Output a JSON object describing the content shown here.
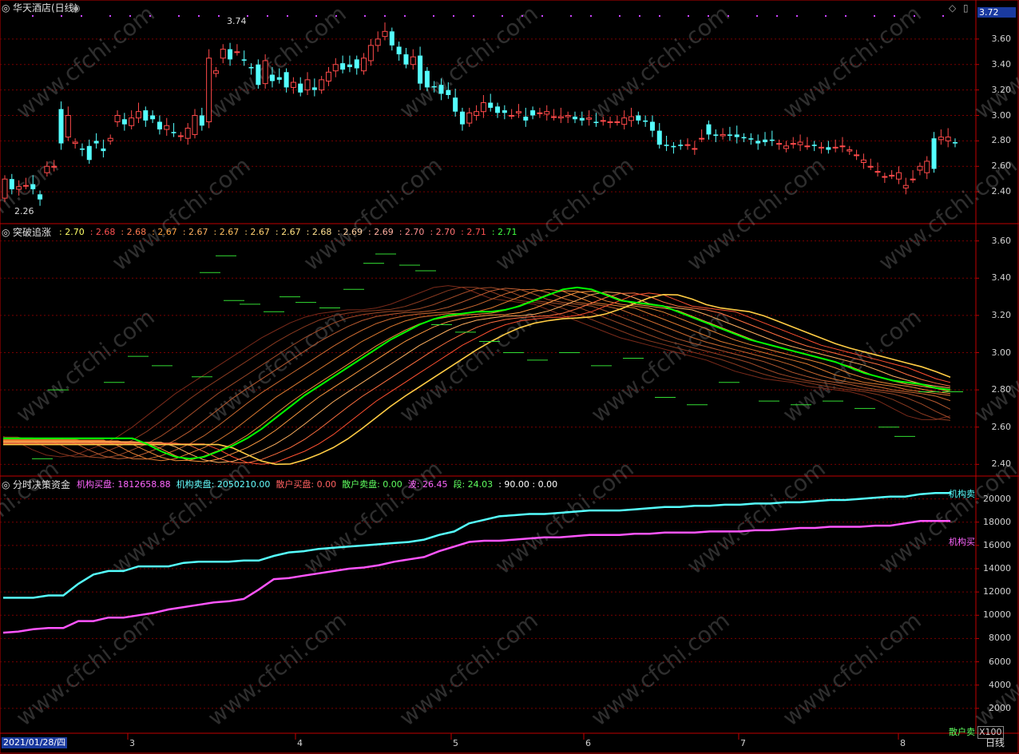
{
  "colors": {
    "up": "#ff4a4a",
    "down": "#54ffff",
    "axis": "#c00000",
    "grid": "#7a0000",
    "text": "#dddddd",
    "green": "#00ff00",
    "magenta": "#ff55ff",
    "cyan": "#55ffff"
  },
  "panel1": {
    "title": "华天酒店(日线)",
    "last_price": "3.72",
    "high_mark": "3.74",
    "low_mark": "2.26",
    "y_ticks": [
      "3.60",
      "3.40",
      "3.20",
      "3.00",
      "2.80",
      "2.60",
      "2.40"
    ],
    "icons": [
      "collapse-icon",
      "diamond-icon",
      "scroll-icon"
    ]
  },
  "panel2": {
    "title": "突破追涨",
    "values": [
      {
        "text": ": 2.70",
        "color": "#ffff66"
      },
      {
        "text": ": 2.68",
        "color": "#ff5050"
      },
      {
        "text": ": 2.68",
        "color": "#ff7a50"
      },
      {
        "text": ": 2.67",
        "color": "#ffa040"
      },
      {
        "text": ": 2.67",
        "color": "#ffb060"
      },
      {
        "text": ": 2.67",
        "color": "#ffc060"
      },
      {
        "text": ": 2.67",
        "color": "#ffd070"
      },
      {
        "text": ": 2.67",
        "color": "#ffe080"
      },
      {
        "text": ": 2.68",
        "color": "#ffe090"
      },
      {
        "text": ": 2.69",
        "color": "#ffd0a0"
      },
      {
        "text": ": 2.69",
        "color": "#ffb0a0"
      },
      {
        "text": ": 2.70",
        "color": "#ff9090"
      },
      {
        "text": ": 2.70",
        "color": "#ff7070"
      },
      {
        "text": ": 2.71",
        "color": "#ff5050"
      },
      {
        "text": ": 2.71",
        "color": "#40ff40"
      }
    ],
    "y_ticks": [
      "3.60",
      "3.40",
      "3.20",
      "3.00",
      "2.80",
      "2.60",
      "2.40"
    ]
  },
  "panel3": {
    "title": "分时决策资金",
    "fields": [
      {
        "text": "机构买盘: 1812658.88",
        "color": "#ff66ff"
      },
      {
        "text": "机构卖盘: 2050210.00",
        "color": "#66ffff"
      },
      {
        "text": "散户买盘: 0.00",
        "color": "#ff6060"
      },
      {
        "text": "散户卖盘: 0.00",
        "color": "#60ff60"
      },
      {
        "text": "波: 26.45",
        "color": "#ff66ff"
      },
      {
        "text": "段: 24.03",
        "color": "#60ff60"
      },
      {
        "text": ": 90.00 : 0.00",
        "color": "#ffffff"
      }
    ],
    "y_ticks": [
      "20000",
      "18000",
      "16000",
      "14000",
      "12000",
      "10000",
      "8000",
      "6000",
      "4000",
      "2000"
    ],
    "line_labels": {
      "inst_sell": "机构卖",
      "inst_buy": "机构买",
      "retail_sell": "散户卖"
    },
    "unit": "X100"
  },
  "x_axis": {
    "date": "2021/01/28/四",
    "months": [
      "3",
      "4",
      "5",
      "6",
      "7",
      "8"
    ],
    "period": "日线"
  },
  "watermark": "www.cfchi.com",
  "chart_data": [
    {
      "type": "candlestick",
      "title": "华天酒店(日线)",
      "ylim": [
        2.2,
        3.8
      ],
      "open": [
        2.35,
        2.5,
        2.42,
        2.45,
        2.46,
        2.38,
        2.55,
        2.6,
        3.05,
        2.83,
        2.78,
        2.74,
        2.76,
        2.8,
        2.74,
        2.8,
        2.95,
        2.97,
        2.92,
        2.98,
        3.04,
        3.0,
        2.95,
        2.89,
        2.87,
        2.84,
        2.82,
        2.85,
        3.0,
        2.95,
        3.33,
        3.45,
        3.52,
        3.5,
        3.44,
        3.38,
        3.4,
        3.25,
        3.32,
        3.3,
        3.34,
        3.22,
        3.25,
        3.2,
        3.22,
        3.2,
        3.27,
        3.35,
        3.41,
        3.4,
        3.44,
        3.35,
        3.43,
        3.55,
        3.62,
        3.66,
        3.54,
        3.48,
        3.4,
        3.47,
        3.35,
        3.23,
        3.24,
        3.2,
        3.14,
        3.03,
        2.94,
        3.0,
        3.03,
        3.1,
        3.07,
        3.04,
        3.0,
        3.02,
        2.99,
        3.04,
        3.02,
        3.01,
        2.99,
        2.98,
        2.99,
        2.99,
        2.98,
        2.97,
        2.95,
        2.96,
        2.95,
        2.95,
        2.93,
        2.96,
        3.0,
        2.96,
        2.95,
        2.88,
        2.77,
        2.76,
        2.77,
        2.77,
        2.74,
        2.82,
        2.93,
        2.85,
        2.84,
        2.85,
        2.85,
        2.83,
        2.82,
        2.8,
        2.81,
        2.81,
        2.78,
        2.74,
        2.78,
        2.77,
        2.76,
        2.77,
        2.75,
        2.75,
        2.75,
        2.76,
        2.72,
        2.69,
        2.63,
        2.6,
        2.56,
        2.52,
        2.53,
        2.5,
        2.43,
        2.5,
        2.57,
        2.55,
        2.82,
        2.81,
        2.8,
        2.79
      ],
      "close": [
        2.5,
        2.42,
        2.44,
        2.45,
        2.42,
        2.34,
        2.6,
        2.6,
        2.78,
        3.0,
        2.79,
        2.73,
        2.65,
        2.78,
        2.72,
        2.82,
        3.0,
        2.93,
        2.98,
        3.03,
        2.96,
        2.97,
        2.89,
        2.92,
        2.86,
        2.84,
        2.9,
        3.0,
        2.92,
        3.45,
        3.35,
        3.52,
        3.44,
        3.5,
        3.43,
        3.37,
        3.24,
        3.43,
        3.27,
        3.28,
        3.22,
        3.26,
        3.18,
        3.28,
        3.2,
        3.28,
        3.34,
        3.4,
        3.36,
        3.38,
        3.37,
        3.45,
        3.55,
        3.6,
        3.66,
        3.55,
        3.48,
        3.4,
        3.46,
        3.25,
        3.22,
        3.22,
        3.17,
        3.16,
        3.03,
        2.93,
        3.02,
        3.03,
        3.1,
        3.06,
        3.02,
        3.02,
        3.0,
        3.03,
        2.96,
        3.0,
        3.02,
        3.03,
        2.99,
        2.99,
        3.0,
        2.97,
        2.96,
        2.98,
        2.94,
        2.96,
        2.95,
        2.95,
        2.98,
        2.99,
        2.96,
        2.95,
        2.88,
        2.77,
        2.76,
        2.75,
        2.76,
        2.77,
        2.74,
        2.82,
        2.85,
        2.84,
        2.85,
        2.84,
        2.83,
        2.82,
        2.81,
        2.78,
        2.79,
        2.8,
        2.78,
        2.76,
        2.78,
        2.79,
        2.76,
        2.76,
        2.75,
        2.73,
        2.75,
        2.76,
        2.73,
        2.69,
        2.65,
        2.6,
        2.56,
        2.52,
        2.53,
        2.55,
        2.45,
        2.5,
        2.6,
        2.64,
        2.58,
        2.83,
        2.83,
        2.78,
        2.8,
        2.8
      ]
    },
    {
      "type": "line",
      "title": "突破追涨",
      "ylim": [
        2.35,
        3.65
      ],
      "series": [
        {
          "name": "",
          "values": [
            2.55,
            2.52,
            2.48,
            2.45,
            2.44,
            2.45,
            2.48,
            2.51,
            2.55,
            2.6,
            2.66,
            2.72,
            2.78,
            2.83,
            2.88,
            2.93,
            2.98,
            3.03,
            3.08,
            3.12,
            3.16,
            3.19,
            3.21,
            3.22,
            3.23,
            3.23,
            3.24,
            3.26,
            3.29,
            3.32,
            3.35,
            3.36,
            3.35,
            3.32,
            3.29,
            3.28,
            3.27,
            3.26,
            3.23,
            3.2,
            3.17,
            3.14,
            3.11,
            3.08,
            3.06,
            3.04,
            3.02,
            3.0,
            2.98,
            2.96,
            2.93,
            2.9,
            2.88,
            2.86,
            2.85,
            2.84,
            2.82,
            2.81,
            2.8,
            2.79,
            2.77,
            2.74,
            2.7,
            2.66,
            2.64,
            2.64,
            2.66
          ]
        }
      ]
    },
    {
      "type": "line",
      "title": "分时决策资金",
      "ylim": [
        0,
        21000
      ],
      "series": [
        {
          "name": "机构卖盘",
          "values": [
            11500,
            11500,
            11500,
            11700,
            11700,
            12700,
            13500,
            13800,
            13800,
            14200,
            14200,
            14200,
            14500,
            14600,
            14600,
            14600,
            14700,
            14700,
            15100,
            15400,
            15500,
            15700,
            15800,
            15900,
            16000,
            16100,
            16200,
            16300,
            16500,
            16900,
            17200,
            17900,
            18200,
            18500,
            18600,
            18700,
            18700,
            18800,
            18900,
            19000,
            19000,
            19000,
            19100,
            19200,
            19300,
            19300,
            19400,
            19400,
            19500,
            19500,
            19600,
            19600,
            19700,
            19700,
            19800,
            19900,
            19900,
            20000,
            20100,
            20200,
            20200,
            20400,
            20500,
            20500
          ]
        },
        {
          "name": "机构买盘",
          "values": [
            8500,
            8600,
            8800,
            8900,
            8900,
            9500,
            9500,
            9800,
            9800,
            10000,
            10200,
            10500,
            10700,
            10900,
            11100,
            11200,
            11400,
            12200,
            13100,
            13200,
            13400,
            13600,
            13800,
            14000,
            14100,
            14300,
            14600,
            14800,
            15000,
            15500,
            15900,
            16300,
            16400,
            16400,
            16500,
            16600,
            16700,
            16700,
            16800,
            16900,
            16900,
            16900,
            17000,
            17000,
            17100,
            17100,
            17100,
            17200,
            17200,
            17200,
            17300,
            17300,
            17400,
            17500,
            17500,
            17600,
            17600,
            17600,
            17700,
            17700,
            17900,
            18100,
            18100,
            18100
          ]
        }
      ]
    }
  ]
}
